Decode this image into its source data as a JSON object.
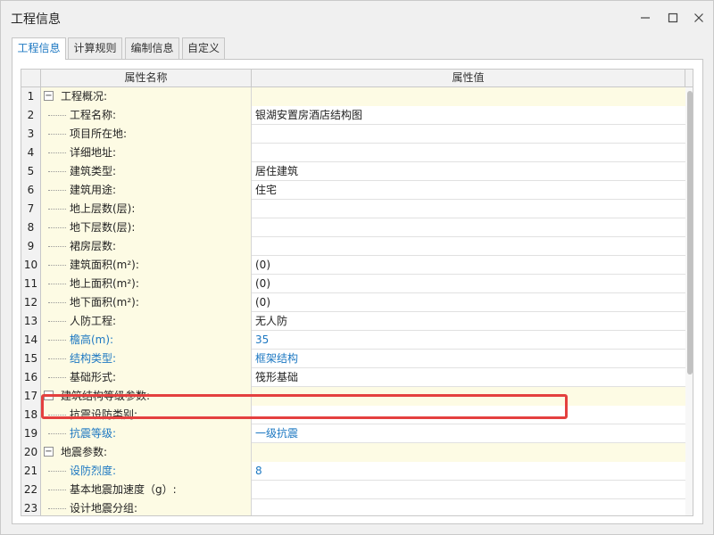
{
  "window": {
    "title": "工程信息"
  },
  "tabs": [
    {
      "label": "工程信息",
      "active": true
    },
    {
      "label": "计算规则",
      "active": false
    },
    {
      "label": "编制信息",
      "active": false
    },
    {
      "label": "自定义",
      "active": false
    }
  ],
  "grid": {
    "headers": {
      "name": "属性名称",
      "value": "属性值"
    },
    "rows": [
      {
        "num": "1",
        "name": "工程概况:",
        "value": "",
        "group": true
      },
      {
        "num": "2",
        "name": "工程名称:",
        "value": "银湖安置房酒店结构图"
      },
      {
        "num": "3",
        "name": "项目所在地:",
        "value": ""
      },
      {
        "num": "4",
        "name": "详细地址:",
        "value": ""
      },
      {
        "num": "5",
        "name": "建筑类型:",
        "value": "居住建筑"
      },
      {
        "num": "6",
        "name": "建筑用途:",
        "value": "住宅"
      },
      {
        "num": "7",
        "name": "地上层数(层):",
        "value": ""
      },
      {
        "num": "8",
        "name": "地下层数(层):",
        "value": ""
      },
      {
        "num": "9",
        "name": "裙房层数:",
        "value": ""
      },
      {
        "num": "10",
        "name": "建筑面积(m²):",
        "value": "(0)"
      },
      {
        "num": "11",
        "name": "地上面积(m²):",
        "value": "(0)"
      },
      {
        "num": "12",
        "name": "地下面积(m²):",
        "value": "(0)"
      },
      {
        "num": "13",
        "name": "人防工程:",
        "value": "无人防"
      },
      {
        "num": "14",
        "name": "檐高(m):",
        "value": "35",
        "blue": true
      },
      {
        "num": "15",
        "name": "结构类型:",
        "value": "框架结构",
        "blue": true
      },
      {
        "num": "16",
        "name": "基础形式:",
        "value": "筏形基础"
      },
      {
        "num": "17",
        "name": "建筑结构等级参数:",
        "value": "",
        "group": true
      },
      {
        "num": "18",
        "name": "抗震设防类别:",
        "value": ""
      },
      {
        "num": "19",
        "name": "抗震等级:",
        "value": "一级抗震",
        "blue": true
      },
      {
        "num": "20",
        "name": "地震参数:",
        "value": "",
        "group": true
      },
      {
        "num": "21",
        "name": "设防烈度:",
        "value": "8",
        "blue": true
      },
      {
        "num": "22",
        "name": "基本地震加速度（g）:",
        "value": ""
      },
      {
        "num": "23",
        "name": "设计地震分组:",
        "value": ""
      }
    ]
  },
  "colors": {
    "accent": "#1d78c2",
    "highlight": "#e4403f",
    "name_bg": "#fdfbe4"
  }
}
